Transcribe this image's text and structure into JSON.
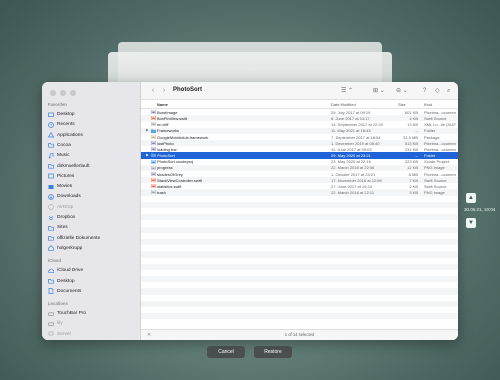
{
  "sidebar": {
    "sections": [
      {
        "title": "Favoriten",
        "items": [
          {
            "label": "Desktop",
            "icon": "desktop-icon"
          },
          {
            "label": "Recents",
            "icon": "clock-icon"
          },
          {
            "label": "Applications",
            "icon": "apps-icon"
          },
          {
            "label": "Cocoa",
            "icon": "folder-icon"
          },
          {
            "label": "Music",
            "icon": "music-icon"
          },
          {
            "label": "dirkmuellerlauft",
            "icon": "folder-icon"
          },
          {
            "label": "Pictures",
            "icon": "pictures-icon"
          },
          {
            "label": "Movies",
            "icon": "movies-icon"
          },
          {
            "label": "Downloads",
            "icon": "download-icon"
          },
          {
            "label": "AirDrop",
            "icon": "airdrop-icon",
            "dim": true
          },
          {
            "label": "Dropbox",
            "icon": "dropbox-icon"
          },
          {
            "label": "Sites",
            "icon": "folder-icon"
          },
          {
            "label": "offizielle Dokumente",
            "icon": "folder-icon"
          },
          {
            "label": "holgerkrupp",
            "icon": "home-icon"
          }
        ]
      },
      {
        "title": "iCloud",
        "items": [
          {
            "label": "iCloud Drive",
            "icon": "cloud-icon"
          },
          {
            "label": "Desktop",
            "icon": "folder-icon"
          },
          {
            "label": "Documents",
            "icon": "document-icon"
          }
        ]
      },
      {
        "title": "Locations",
        "items": [
          {
            "label": "TouchBar Pro",
            "icon": "disk-icon"
          },
          {
            "label": "lily",
            "icon": "disk-icon",
            "dim": true
          },
          {
            "label": "Server",
            "icon": "network-icon",
            "dim": true
          }
        ]
      }
    ]
  },
  "toolbar": {
    "title": "PhotoSort",
    "back_icon": "‹",
    "forward_icon": "›",
    "list_view_icon": "☰ ⌃",
    "grid_icon": "⊞ ⌄",
    "action_icon": "⊖ ⌄",
    "help_icon": "?",
    "tag_icon": "◇",
    "search_icon": "⌕"
  },
  "columns": {
    "name": "Name",
    "date": "Date Modified",
    "size": "Size",
    "kind": "Kind"
  },
  "files": [
    {
      "name": "BurstImage",
      "date": "29. July 2017 at 09:19",
      "size": "601 KB",
      "kind": "Pixelma...ocument",
      "icon": "image-file-icon"
    },
    {
      "name": "BoxPinView.swift",
      "date": "6. June 2017 at 13:17",
      "size": "4 KB",
      "kind": "Swift Source",
      "icon": "swift-file-icon"
    },
    {
      "name": "en.xliff",
      "date": "14. September 2017 at 22:29",
      "size": "13 KB",
      "kind": "XML Lo...ile (XLIFF)",
      "icon": "xml-file-icon"
    },
    {
      "name": "Frameworks",
      "date": "11. May 2021 at 16:43",
      "size": "--",
      "kind": "Folder",
      "icon": "folder-icon",
      "folder": true
    },
    {
      "name": "GoogleMobileAds.framework",
      "date": "7. September 2017 at 18:54",
      "size": "31,5 MB",
      "kind": "Package",
      "icon": "package-icon"
    },
    {
      "name": "lostPhoto",
      "date": "1. December 2019 at 08:40",
      "size": "513 KB",
      "kind": "Pixelma...ocument",
      "icon": "image-file-icon"
    },
    {
      "name": "loading bar",
      "date": "11. June 2017 at 09:03",
      "size": "231 KB",
      "kind": "Pixelma...ocument",
      "icon": "image-file-icon"
    },
    {
      "name": "PhotoSort",
      "date": "29. May 2020 at 23:21",
      "size": "--",
      "kind": "Folder",
      "icon": "folder-icon",
      "folder": true,
      "selected": true
    },
    {
      "name": "PhotoSort.xcodeproj",
      "date": "23. May 2020 at 22:16",
      "size": "223 KB",
      "kind": "Xcode Project",
      "icon": "xcode-icon"
    },
    {
      "name": "progress",
      "date": "22. March 2018 at 22:06",
      "size": "12 KB",
      "kind": "PNG image",
      "icon": "png-file-icon"
    },
    {
      "name": "shadesOfGrey",
      "date": "1. October 2017 at 23:21",
      "size": "8 MB",
      "kind": "Pixelma...ocument",
      "icon": "image-file-icon"
    },
    {
      "name": "StackViewController.swift",
      "date": "17. November 2018 at 12:59",
      "size": "7 KB",
      "kind": "Swift Source",
      "icon": "swift-file-icon"
    },
    {
      "name": "statistics.swift",
      "date": "27. June 2017 at 19:24",
      "size": "2 KB",
      "kind": "Swift Source",
      "icon": "swift-file-icon"
    },
    {
      "name": "trash",
      "date": "22. March 2018 at 22:11",
      "size": "3 KB",
      "kind": "PNG image",
      "icon": "png-file-icon"
    }
  ],
  "status": {
    "text": "1 of 14 selected"
  },
  "buttons": {
    "cancel": "Cancel",
    "restore": "Restore"
  },
  "timeline": {
    "time_label": "30.05.21, 10:04",
    "up_icon": "chevron-up-icon",
    "down_icon": "chevron-down-icon"
  },
  "colors": {
    "selection": "#1f63d6",
    "folder": "#5aa3e8"
  }
}
